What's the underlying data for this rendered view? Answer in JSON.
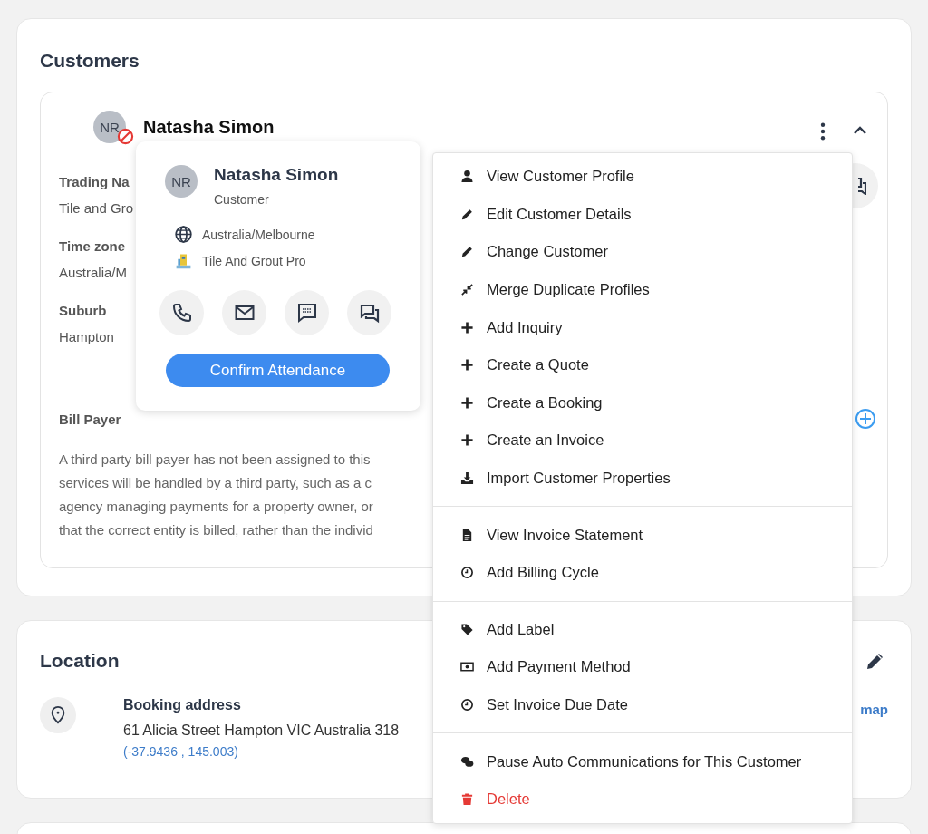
{
  "customers": {
    "title": "Customers",
    "customer": {
      "initials": "NR",
      "blocked": true,
      "name": "Natasha Simon",
      "expanded": true
    },
    "fields": [
      {
        "label": "Trading Na",
        "value": "Tile and Gro"
      },
      {
        "label": "Time zone",
        "value": "Australia/M"
      },
      {
        "label": "Suburb",
        "value": "Hampton"
      }
    ],
    "bill_payer": {
      "label": "Bill Payer",
      "lines": [
        "A third party bill payer has not been assigned to this",
        "services will be handled by a third party, such as a c",
        "agency managing payments for a property owner, or",
        "that the correct entity is billed, rather than the individ"
      ]
    }
  },
  "popover": {
    "initials": "NR",
    "name": "Natasha Simon",
    "role": "Customer",
    "timezone": "Australia/Melbourne",
    "company": "Tile And Grout Pro",
    "button": "Confirm Attendance"
  },
  "menu": {
    "groups": [
      {
        "items": [
          {
            "label": "View Customer Profile",
            "danger": false
          },
          {
            "label": "Edit Customer Details",
            "danger": false
          },
          {
            "label": "Change Customer",
            "danger": false
          },
          {
            "label": "Merge Duplicate Profiles",
            "danger": false
          },
          {
            "label": "Add Inquiry",
            "danger": false
          },
          {
            "label": "Create a Quote",
            "danger": false
          },
          {
            "label": "Create a Booking",
            "danger": false
          },
          {
            "label": "Create an Invoice",
            "danger": false
          },
          {
            "label": "Import Customer Properties",
            "danger": false
          }
        ]
      },
      {
        "items": [
          {
            "label": "View Invoice Statement",
            "danger": false
          },
          {
            "label": "Add Billing Cycle",
            "danger": false
          }
        ]
      },
      {
        "items": [
          {
            "label": "Add Label",
            "danger": false
          },
          {
            "label": "Add Payment Method",
            "danger": false
          },
          {
            "label": "Set Invoice Due Date",
            "danger": false
          }
        ]
      },
      {
        "items": [
          {
            "label": "Pause Auto Communications for This Customer",
            "danger": false
          },
          {
            "label": "Delete",
            "danger": true
          }
        ]
      }
    ]
  },
  "location": {
    "title": "Location",
    "map_link": "map",
    "address_label": "Booking address",
    "address": "61 Alicia Street Hampton VIC Australia 318",
    "coordinates": "(-37.9436 , 145.003)"
  }
}
